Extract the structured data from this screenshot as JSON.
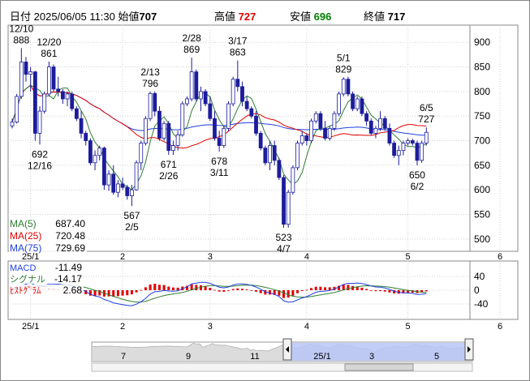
{
  "header": {
    "date_label": "日付",
    "datetime": "2025/06/05 11:30",
    "open_label": "始値",
    "open": "707",
    "high_label": "高値",
    "high": "727",
    "low_label": "安値",
    "low": "696",
    "close_label": "終値",
    "close": "717"
  },
  "colors": {
    "up": "#ffffff",
    "down": "#1c1c9c",
    "ma5": "#2e7d32",
    "ma25": "#e00000",
    "ma75": "#1f3fdf",
    "macd": "#1f3fdf",
    "signal": "#2e7d32",
    "hist": "#e00000",
    "nav_fill": "#b9c6f7",
    "nav_hist": "#dcdcdc"
  },
  "chart_data": [
    {
      "type": "candlestick",
      "title": "",
      "y_ticks": [
        500,
        550,
        600,
        650,
        700,
        750,
        800,
        850,
        900
      ],
      "ylim": [
        475,
        935
      ],
      "x_ticks": [
        {
          "label": "25/1",
          "index": 4
        },
        {
          "label": "2",
          "index": 24
        },
        {
          "label": "3",
          "index": 43
        },
        {
          "label": "4",
          "index": 64
        },
        {
          "label": "5",
          "index": 86
        },
        {
          "label": "6",
          "index": 106
        }
      ],
      "candles": [
        [
          0,
          730,
          745,
          725,
          738
        ],
        [
          1,
          738,
          795,
          735,
          790
        ],
        [
          2,
          790,
          888,
          785,
          860
        ],
        [
          3,
          860,
          870,
          820,
          835
        ],
        [
          4,
          835,
          850,
          800,
          840
        ],
        [
          5,
          840,
          842,
          700,
          715
        ],
        [
          6,
          715,
          770,
          692,
          760
        ],
        [
          7,
          760,
          800,
          755,
          795
        ],
        [
          8,
          795,
          861,
          790,
          850
        ],
        [
          9,
          850,
          855,
          800,
          805
        ],
        [
          10,
          805,
          830,
          790,
          800
        ],
        [
          11,
          800,
          805,
          775,
          785
        ],
        [
          12,
          785,
          800,
          770,
          795
        ],
        [
          13,
          795,
          800,
          760,
          765
        ],
        [
          14,
          765,
          770,
          740,
          745
        ],
        [
          15,
          745,
          760,
          705,
          715
        ],
        [
          16,
          715,
          720,
          690,
          700
        ],
        [
          17,
          700,
          705,
          650,
          655
        ],
        [
          18,
          655,
          680,
          640,
          670
        ],
        [
          19,
          670,
          690,
          660,
          685
        ],
        [
          20,
          685,
          688,
          600,
          610
        ],
        [
          21,
          610,
          640,
          598,
          632
        ],
        [
          22,
          632,
          650,
          590,
          595
        ],
        [
          23,
          595,
          620,
          585,
          612
        ],
        [
          24,
          612,
          625,
          600,
          605
        ],
        [
          25,
          605,
          610,
          580,
          588
        ],
        [
          26,
          588,
          610,
          567,
          600
        ],
        [
          27,
          600,
          660,
          598,
          655
        ],
        [
          28,
          655,
          700,
          640,
          695
        ],
        [
          29,
          695,
          750,
          690,
          745
        ],
        [
          30,
          745,
          800,
          740,
          796
        ],
        [
          31,
          796,
          800,
          750,
          760
        ],
        [
          32,
          760,
          770,
          700,
          705
        ],
        [
          33,
          705,
          740,
          700,
          735
        ],
        [
          34,
          735,
          740,
          671,
          680
        ],
        [
          35,
          680,
          700,
          671,
          690
        ],
        [
          36,
          690,
          720,
          680,
          712
        ],
        [
          37,
          712,
          780,
          708,
          775
        ],
        [
          38,
          775,
          790,
          770,
          785
        ],
        [
          39,
          785,
          869,
          780,
          840
        ],
        [
          40,
          840,
          845,
          780,
          785
        ],
        [
          41,
          785,
          810,
          760,
          800
        ],
        [
          42,
          800,
          805,
          770,
          775
        ],
        [
          43,
          775,
          790,
          740,
          745
        ],
        [
          44,
          745,
          760,
          700,
          705
        ],
        [
          45,
          705,
          720,
          678,
          690
        ],
        [
          46,
          690,
          730,
          685,
          725
        ],
        [
          47,
          725,
          780,
          720,
          775
        ],
        [
          48,
          775,
          830,
          770,
          825
        ],
        [
          49,
          825,
          863,
          800,
          810
        ],
        [
          50,
          810,
          820,
          770,
          780
        ],
        [
          51,
          780,
          790,
          760,
          765
        ],
        [
          52,
          765,
          770,
          745,
          750
        ],
        [
          53,
          750,
          760,
          710,
          715
        ],
        [
          54,
          715,
          720,
          680,
          685
        ],
        [
          55,
          685,
          690,
          650,
          655
        ],
        [
          56,
          655,
          700,
          640,
          690
        ],
        [
          57,
          690,
          700,
          650,
          660
        ],
        [
          58,
          660,
          665,
          620,
          625
        ],
        [
          59,
          625,
          630,
          523,
          530
        ],
        [
          60,
          530,
          600,
          523,
          595
        ],
        [
          61,
          595,
          650,
          590,
          645
        ],
        [
          62,
          645,
          700,
          640,
          695
        ],
        [
          63,
          695,
          720,
          690,
          710
        ],
        [
          64,
          710,
          715,
          690,
          700
        ],
        [
          65,
          700,
          745,
          695,
          740
        ],
        [
          66,
          740,
          760,
          735,
          755
        ],
        [
          67,
          755,
          760,
          720,
          725
        ],
        [
          68,
          725,
          740,
          700,
          705
        ],
        [
          69,
          705,
          730,
          700,
          725
        ],
        [
          70,
          725,
          760,
          720,
          755
        ],
        [
          71,
          755,
          800,
          750,
          795
        ],
        [
          72,
          795,
          829,
          790,
          825
        ],
        [
          73,
          825,
          830,
          790,
          795
        ],
        [
          74,
          795,
          800,
          760,
          765
        ],
        [
          75,
          765,
          790,
          760,
          785
        ],
        [
          76,
          785,
          790,
          750,
          755
        ],
        [
          77,
          755,
          760,
          730,
          740
        ],
        [
          78,
          740,
          745,
          710,
          715
        ],
        [
          79,
          715,
          730,
          705,
          725
        ],
        [
          80,
          725,
          760,
          720,
          745
        ],
        [
          81,
          745,
          750,
          720,
          725
        ],
        [
          82,
          725,
          735,
          690,
          695
        ],
        [
          83,
          695,
          700,
          665,
          670
        ],
        [
          84,
          670,
          690,
          650,
          680
        ],
        [
          85,
          680,
          700,
          670,
          695
        ],
        [
          86,
          695,
          705,
          690,
          700
        ],
        [
          87,
          700,
          704,
          690,
          695
        ],
        [
          88,
          695,
          700,
          650,
          660
        ],
        [
          89,
          660,
          700,
          655,
          695
        ],
        [
          90,
          695,
          727,
          690,
          717
        ]
      ],
      "series": [
        {
          "name": "MA(5)",
          "value_label": "687.40"
        },
        {
          "name": "MA(25)",
          "value_label": "720.48"
        },
        {
          "name": "MA(75)",
          "value_label": "729.69"
        }
      ],
      "annotations": [
        {
          "type": "high",
          "date": "12/10",
          "value": "888",
          "index": 2
        },
        {
          "type": "high",
          "date": "12/20",
          "value": "861",
          "index": 8
        },
        {
          "type": "low",
          "date": "12/16",
          "value": "692",
          "index": 6
        },
        {
          "type": "high",
          "date": "2/13",
          "value": "796",
          "index": 30
        },
        {
          "type": "low",
          "date": "2/5",
          "value": "567",
          "index": 26
        },
        {
          "type": "high",
          "date": "2/28",
          "value": "869",
          "index": 39
        },
        {
          "type": "low",
          "date": "2/26",
          "value": "671",
          "index": 34
        },
        {
          "type": "high",
          "date": "3/17",
          "value": "863",
          "index": 49
        },
        {
          "type": "low",
          "date": "3/11",
          "value": "678",
          "index": 45
        },
        {
          "type": "low",
          "date": "4/7",
          "value": "523",
          "index": 59
        },
        {
          "type": "high",
          "date": "5/1",
          "value": "829",
          "index": 72
        },
        {
          "type": "low",
          "date": "6/2",
          "value": "650",
          "index": 88
        },
        {
          "type": "high",
          "date": "6/5",
          "value": "727",
          "index": 90
        }
      ]
    },
    {
      "type": "macd",
      "y_ticks": [
        40,
        0,
        -40
      ],
      "ylim": [
        -85,
        85
      ],
      "series": [
        {
          "name": "MACD",
          "value_label": "-11.49"
        },
        {
          "name": "シグナル",
          "value_label": "-14.17"
        },
        {
          "name": "ﾋｽﾄｸﾞﾗﾑ",
          "value_label": "2.68"
        }
      ]
    }
  ],
  "navigator": {
    "labels": [
      "7",
      "9",
      "11",
      "25/1",
      "3",
      "5"
    ]
  }
}
